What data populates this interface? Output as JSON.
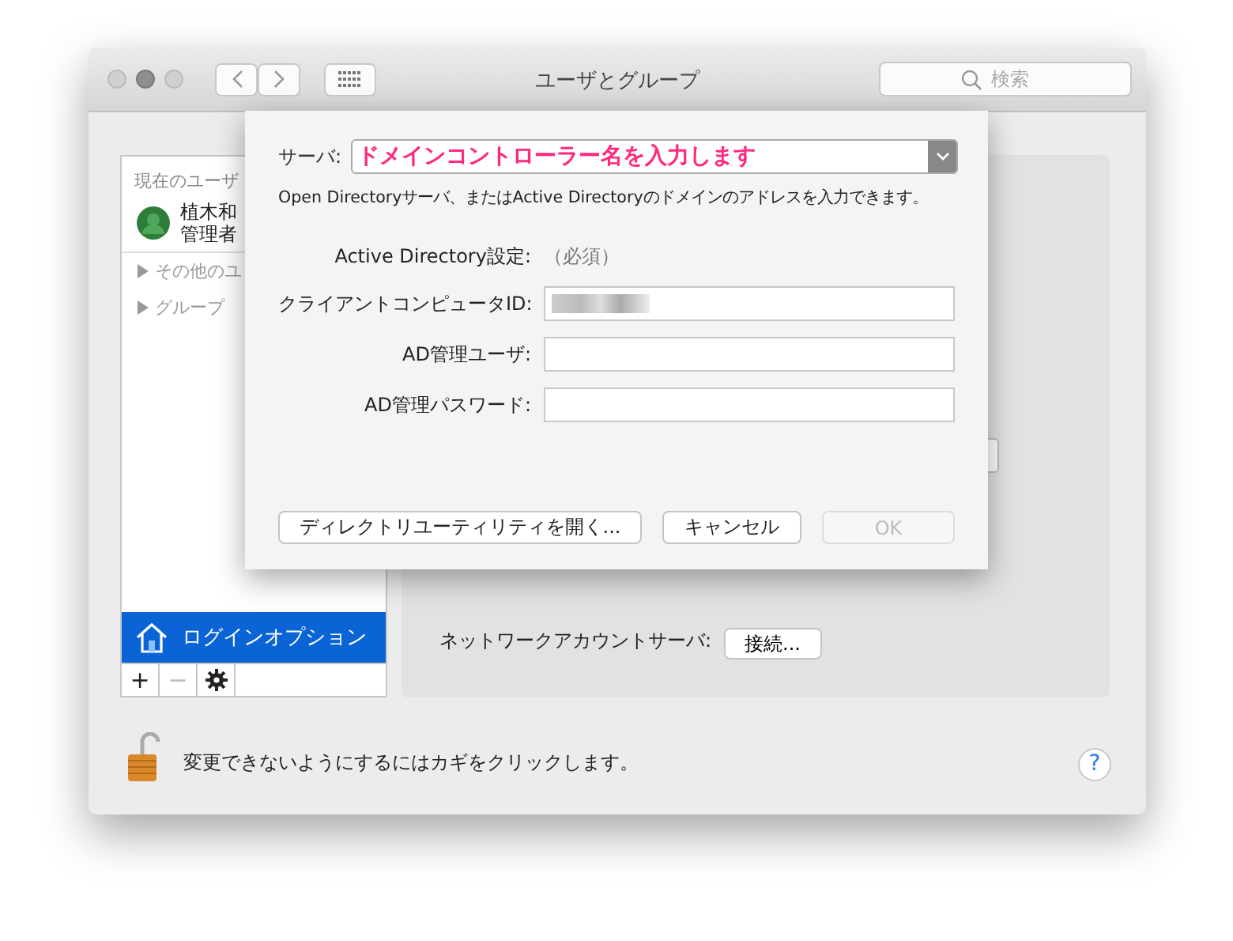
{
  "window": {
    "title": "ユーザとグループ",
    "search": {
      "placeholder": "検索"
    }
  },
  "sidebar": {
    "section": "現在のユーザ",
    "current_user": {
      "name": "植木和",
      "role": "管理者"
    },
    "groups": [
      {
        "label": "その他のユ",
        "expanded": false
      },
      {
        "label": "グループ",
        "expanded": false
      }
    ],
    "login_options": {
      "label": "ログインオプション",
      "selected": true
    },
    "toolbar": [
      {
        "kind": "text",
        "label": "+",
        "disabled": false
      },
      {
        "kind": "text",
        "label": "−",
        "disabled": true
      },
      {
        "kind": "gear",
        "disabled": false
      }
    ]
  },
  "panel": {
    "network_server_label": "ネットワークアカウントサーバ:",
    "connect_button": "接続..."
  },
  "sheet": {
    "server_label": "サーバ:",
    "server_value": "ドメインコントローラー名を入力します",
    "hint": "Open Directoryサーバ、またはActive Directoryのドメインのアドレスを入力できます。",
    "section_label": "Active Directory設定:",
    "section_note": "（必須）",
    "fields": [
      {
        "label": "クライアントコンピュータID:",
        "redacted": true
      },
      {
        "label": "AD管理ユーザ:",
        "redacted": false
      },
      {
        "label": "AD管理パスワード:",
        "redacted": false
      }
    ],
    "buttons": [
      {
        "label": "ディレクトリユーティリティを開く...",
        "disabled": false
      },
      {
        "label": "キャンセル",
        "disabled": false
      },
      {
        "label": "OK",
        "disabled": true
      }
    ]
  },
  "footer": {
    "lock_text": "変更できないようにするにはカギをクリックします。",
    "help": "?"
  }
}
